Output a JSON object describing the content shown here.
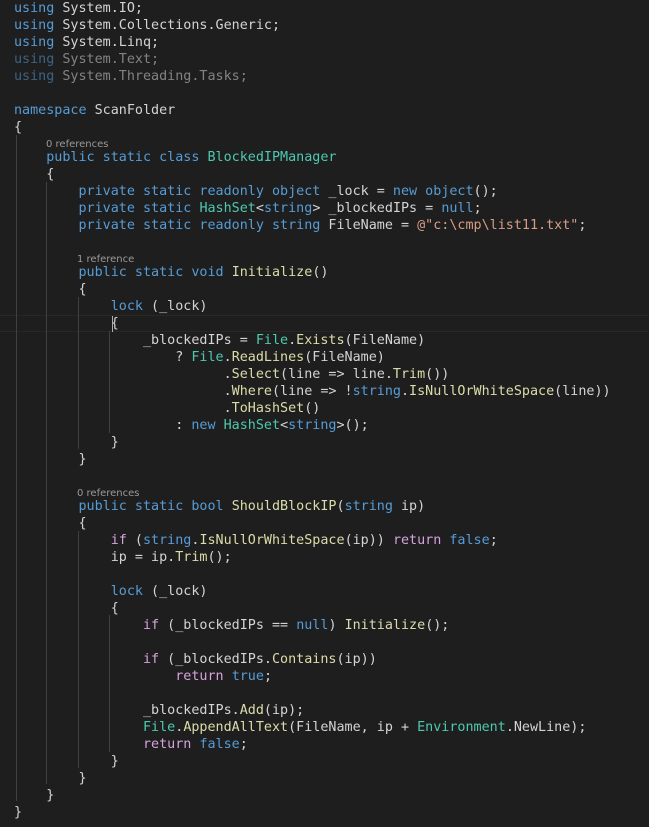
{
  "editor": {
    "theme": {
      "background": "#1e1e1e",
      "text": "#d4d4d4",
      "keyword": "#569cd6",
      "control": "#d8a0df",
      "type": "#4ec9b0",
      "method": "#dcdcaa",
      "string": "#d69d85",
      "codelens": "#999999"
    },
    "codelens": [
      "0 references",
      "1 reference",
      "0 references"
    ],
    "lines": [
      [
        [
          "kw",
          "using"
        ],
        [
          "p",
          " System.IO;"
        ]
      ],
      [
        [
          "kw",
          "using"
        ],
        [
          "p",
          " System.Collections.Generic;"
        ]
      ],
      [
        [
          "kw",
          "using"
        ],
        [
          "p",
          " System.Linq;"
        ]
      ],
      [
        [
          "kw dim",
          "using"
        ],
        [
          "p dim",
          " System.Text;"
        ]
      ],
      [
        [
          "kw dim",
          "using"
        ],
        [
          "p dim",
          " System.Threading.Tasks;"
        ]
      ],
      [],
      [
        [
          "kw",
          "namespace"
        ],
        [
          "p",
          " ScanFolder"
        ]
      ],
      [
        [
          "p",
          "{"
        ]
      ],
      [
        [
          "p",
          "    "
        ],
        [
          "kw",
          "public static class"
        ],
        [
          "p",
          " "
        ],
        [
          "cls",
          "BlockedIPManager"
        ]
      ],
      [
        [
          "p",
          "    {"
        ]
      ],
      [
        [
          "p",
          "        "
        ],
        [
          "kw",
          "private static readonly object"
        ],
        [
          "p",
          " _lock = "
        ],
        [
          "kw",
          "new object"
        ],
        [
          "p",
          "();"
        ]
      ],
      [
        [
          "p",
          "        "
        ],
        [
          "kw",
          "private static"
        ],
        [
          "p",
          " "
        ],
        [
          "cls",
          "HashSet"
        ],
        [
          "p",
          "<"
        ],
        [
          "kw",
          "string"
        ],
        [
          "p",
          "> _blockedIPs = "
        ],
        [
          "kw",
          "null"
        ],
        [
          "p",
          ";"
        ]
      ],
      [
        [
          "p",
          "        "
        ],
        [
          "kw",
          "private static readonly string"
        ],
        [
          "p",
          " FileName = "
        ],
        [
          "str",
          "@\"c:\\cmp\\list11.txt\""
        ],
        [
          "p",
          ";"
        ]
      ],
      [],
      [
        [
          "p",
          "        "
        ],
        [
          "kw",
          "public static void"
        ],
        [
          "p",
          " "
        ],
        [
          "fn",
          "Initialize"
        ],
        [
          "p",
          "()"
        ]
      ],
      [
        [
          "p",
          "        {"
        ]
      ],
      [
        [
          "p",
          "            "
        ],
        [
          "kw",
          "lock"
        ],
        [
          "p",
          " (_lock)"
        ]
      ],
      [
        [
          "p",
          "            {"
        ]
      ],
      [
        [
          "p",
          "                _blockedIPs = "
        ],
        [
          "cls",
          "File"
        ],
        [
          "p",
          "."
        ],
        [
          "fn",
          "Exists"
        ],
        [
          "p",
          "(FileName)"
        ]
      ],
      [
        [
          "p",
          "                    ? "
        ],
        [
          "cls",
          "File"
        ],
        [
          "p",
          "."
        ],
        [
          "fn",
          "ReadLines"
        ],
        [
          "p",
          "(FileName)"
        ]
      ],
      [
        [
          "p",
          "                          ."
        ],
        [
          "fn",
          "Select"
        ],
        [
          "p",
          "(line => line."
        ],
        [
          "fn",
          "Trim"
        ],
        [
          "p",
          "())"
        ]
      ],
      [
        [
          "p",
          "                          ."
        ],
        [
          "fn",
          "Where"
        ],
        [
          "p",
          "(line => !"
        ],
        [
          "kw",
          "string"
        ],
        [
          "p",
          "."
        ],
        [
          "fn",
          "IsNullOrWhiteSpace"
        ],
        [
          "p",
          "(line))"
        ]
      ],
      [
        [
          "p",
          "                          ."
        ],
        [
          "fn",
          "ToHashSet"
        ],
        [
          "p",
          "()"
        ]
      ],
      [
        [
          "p",
          "                    : "
        ],
        [
          "kw",
          "new"
        ],
        [
          "p",
          " "
        ],
        [
          "cls",
          "HashSet"
        ],
        [
          "p",
          "<"
        ],
        [
          "kw",
          "string"
        ],
        [
          "p",
          ">();"
        ]
      ],
      [
        [
          "p",
          "            }"
        ]
      ],
      [
        [
          "p",
          "        }"
        ]
      ],
      [],
      [
        [
          "p",
          "        "
        ],
        [
          "kw",
          "public static bool"
        ],
        [
          "p",
          " "
        ],
        [
          "fn",
          "ShouldBlockIP"
        ],
        [
          "p",
          "("
        ],
        [
          "kw",
          "string"
        ],
        [
          "p",
          " ip)"
        ]
      ],
      [
        [
          "p",
          "        {"
        ]
      ],
      [
        [
          "p",
          "            "
        ],
        [
          "ctl",
          "if"
        ],
        [
          "p",
          " ("
        ],
        [
          "kw",
          "string"
        ],
        [
          "p",
          "."
        ],
        [
          "fn",
          "IsNullOrWhiteSpace"
        ],
        [
          "p",
          "(ip)) "
        ],
        [
          "ctl",
          "return"
        ],
        [
          "p",
          " "
        ],
        [
          "kw",
          "false"
        ],
        [
          "p",
          ";"
        ]
      ],
      [
        [
          "p",
          "            ip = ip."
        ],
        [
          "fn",
          "Trim"
        ],
        [
          "p",
          "();"
        ]
      ],
      [],
      [
        [
          "p",
          "            "
        ],
        [
          "kw",
          "lock"
        ],
        [
          "p",
          " (_lock)"
        ]
      ],
      [
        [
          "p",
          "            {"
        ]
      ],
      [
        [
          "p",
          "                "
        ],
        [
          "ctl",
          "if"
        ],
        [
          "p",
          " (_blockedIPs == "
        ],
        [
          "kw",
          "null"
        ],
        [
          "p",
          ") "
        ],
        [
          "fn",
          "Initialize"
        ],
        [
          "p",
          "();"
        ]
      ],
      [],
      [
        [
          "p",
          "                "
        ],
        [
          "ctl",
          "if"
        ],
        [
          "p",
          " (_blockedIPs."
        ],
        [
          "fn",
          "Contains"
        ],
        [
          "p",
          "(ip))"
        ]
      ],
      [
        [
          "p",
          "                    "
        ],
        [
          "ctl",
          "return"
        ],
        [
          "p",
          " "
        ],
        [
          "kw",
          "true"
        ],
        [
          "p",
          ";"
        ]
      ],
      [],
      [
        [
          "p",
          "                _blockedIPs."
        ],
        [
          "fn",
          "Add"
        ],
        [
          "p",
          "(ip);"
        ]
      ],
      [
        [
          "p",
          "                "
        ],
        [
          "cls",
          "File"
        ],
        [
          "p",
          "."
        ],
        [
          "fn",
          "AppendAllText"
        ],
        [
          "p",
          "(FileName, ip + "
        ],
        [
          "cls",
          "Environment"
        ],
        [
          "p",
          ".NewLine);"
        ]
      ],
      [
        [
          "p",
          "                "
        ],
        [
          "ctl",
          "return"
        ],
        [
          "p",
          " "
        ],
        [
          "kw",
          "false"
        ],
        [
          "p",
          ";"
        ]
      ],
      [
        [
          "p",
          "            }"
        ]
      ],
      [
        [
          "p",
          "        }"
        ]
      ],
      [
        [
          "p",
          "    }"
        ]
      ],
      [
        [
          "p",
          "}"
        ]
      ]
    ]
  }
}
